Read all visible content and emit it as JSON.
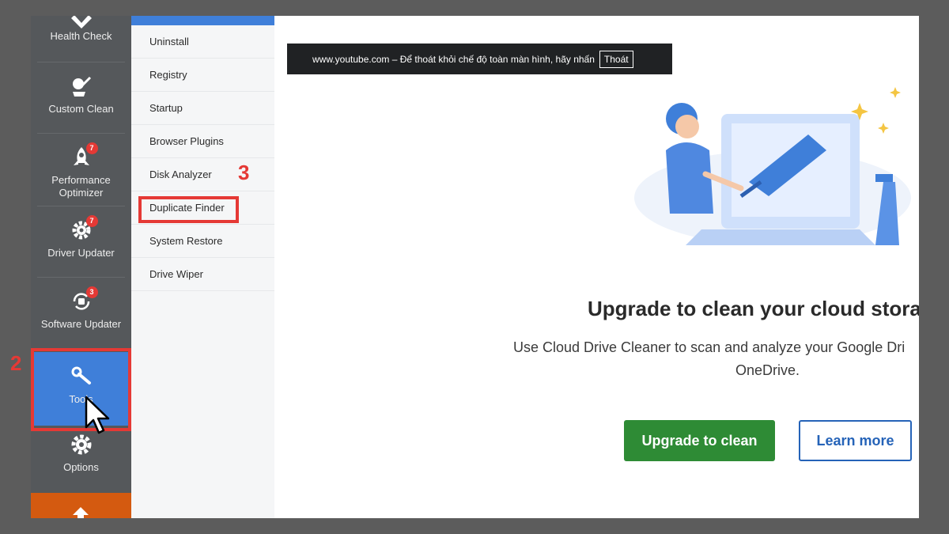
{
  "sidebar": {
    "items": [
      {
        "label": "Health Check",
        "icon": "health-check-icon"
      },
      {
        "label": "Custom Clean",
        "icon": "custom-clean-icon"
      },
      {
        "label": "Performance\nOptimizer",
        "icon": "rocket-icon",
        "badge": "7"
      },
      {
        "label": "Driver Updater",
        "icon": "gear-icon",
        "badge": "7"
      },
      {
        "label": "Software Updater",
        "icon": "refresh-icon",
        "badge": "3"
      },
      {
        "label": "Tools",
        "icon": "wrench-icon"
      },
      {
        "label": "Options",
        "icon": "settings-icon"
      }
    ]
  },
  "submenu": {
    "items": [
      "Uninstall",
      "Registry",
      "Startup",
      "Browser Plugins",
      "Disk Analyzer",
      "Duplicate Finder",
      "System Restore",
      "Drive Wiper"
    ]
  },
  "banner": {
    "text": "www.youtube.com – Để thoát khỏi chế độ toàn màn hình, hãy nhấn",
    "exit_label": "Thoát"
  },
  "promo": {
    "title": "Upgrade to clean your cloud stora",
    "desc_line1": "Use Cloud Drive Cleaner to scan and analyze your Google Dri",
    "desc_line2": "OneDrive.",
    "upgrade_label": "Upgrade to clean",
    "learn_label": "Learn more"
  },
  "annotations": {
    "step2": "2",
    "step3": "3"
  },
  "colors": {
    "accent": "#3f7fd9",
    "sidebar_bg": "#55585b",
    "upgrade_green": "#2e8b35",
    "learn_blue": "#2563b8",
    "annotation_red": "#e53935"
  }
}
